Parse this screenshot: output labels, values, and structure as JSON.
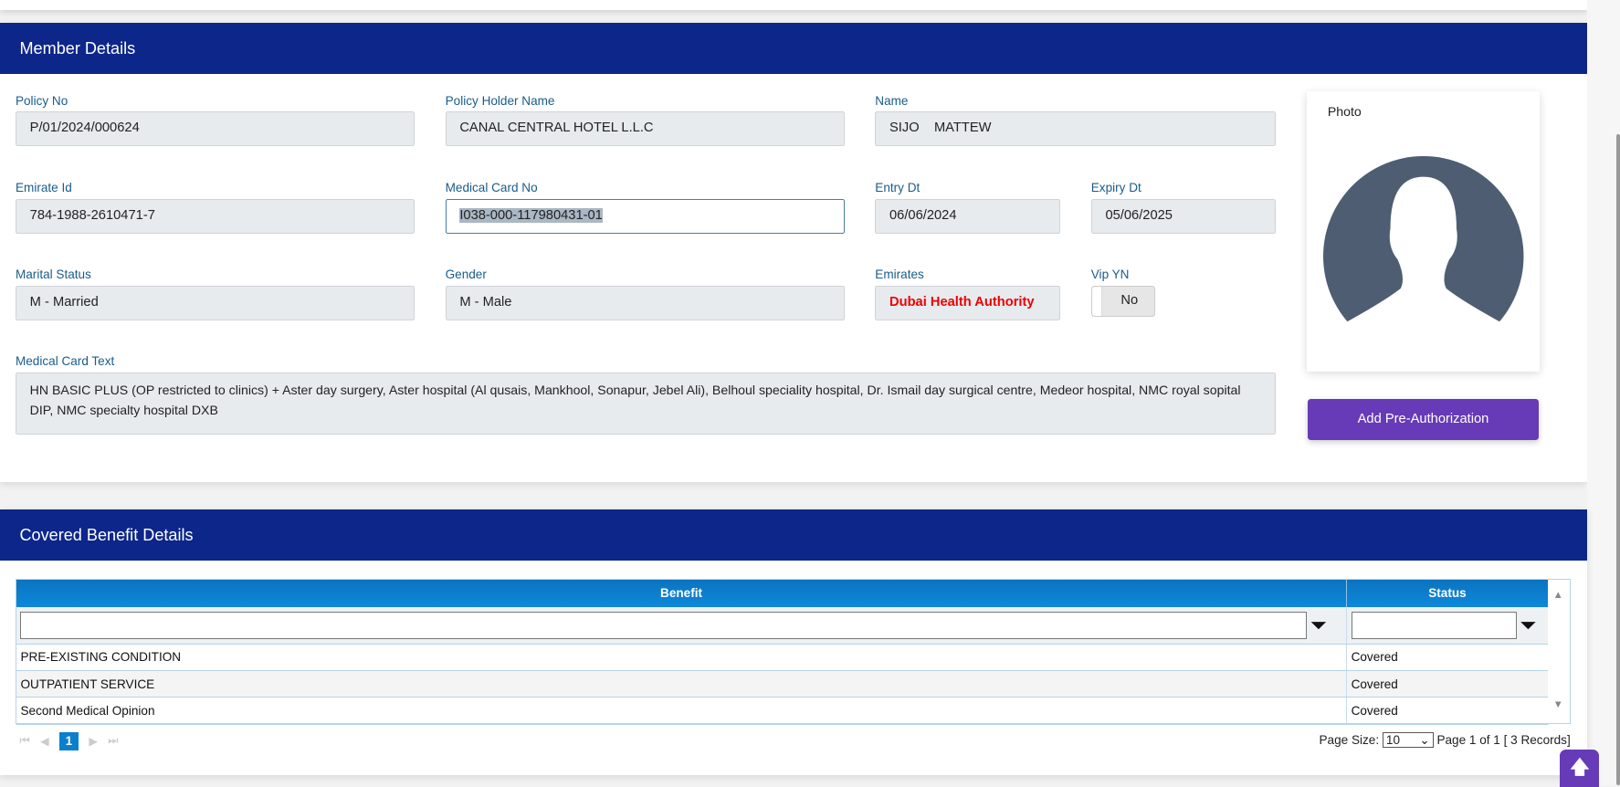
{
  "member": {
    "title": "Member Details",
    "policy_no": {
      "label": "Policy No",
      "value": "P/01/2024/000624"
    },
    "policy_holder": {
      "label": "Policy Holder Name",
      "value": "CANAL CENTRAL HOTEL L.L.C"
    },
    "name": {
      "label": "Name",
      "value": "SIJO    MATTEW"
    },
    "emirate_id": {
      "label": "Emirate Id",
      "value": "784-1988-2610471-7"
    },
    "medical_card_no": {
      "label": "Medical Card No",
      "value": "I038-000-117980431-01"
    },
    "entry_dt": {
      "label": "Entry Dt",
      "value": "06/06/2024"
    },
    "expiry_dt": {
      "label": "Expiry Dt",
      "value": "05/06/2025"
    },
    "marital_status": {
      "label": "Marital Status",
      "value": "M - Married"
    },
    "gender": {
      "label": "Gender",
      "value": "M - Male"
    },
    "emirates": {
      "label": "Emirates",
      "value": "Dubai Health Authority"
    },
    "vip": {
      "label": "Vip YN",
      "value": "No"
    },
    "medical_card_text": {
      "label": "Medical Card Text",
      "value": "HN BASIC PLUS (OP restricted to clinics) + Aster day surgery, Aster hospital (Al qusais, Mankhool, Sonapur, Jebel Ali), Belhoul speciality hospital, Dr. Ismail day surgical centre, Medeor hospital, NMC royal sopital DIP,  NMC specialty hospital DXB"
    },
    "photo_label": "Photo",
    "add_preauth": "Add Pre-Authorization"
  },
  "benefits": {
    "title": "Covered Benefit Details",
    "columns": [
      "Benefit",
      "Status"
    ],
    "rows": [
      {
        "benefit": "PRE-EXISTING CONDITION",
        "status": "Covered"
      },
      {
        "benefit": "OUTPATIENT SERVICE",
        "status": "Covered"
      },
      {
        "benefit": "Second Medical Opinion",
        "status": "Covered"
      }
    ],
    "pager": {
      "current": "1",
      "page_size_label": "Page Size:",
      "page_size": "10",
      "page_info": "Page 1 of 1 [ 3 Records]"
    }
  },
  "colors": {
    "header": "#0d2689",
    "accent": "#673ab7",
    "grid_header": "#0b7fcf",
    "emirates_text": "#ee0000"
  }
}
